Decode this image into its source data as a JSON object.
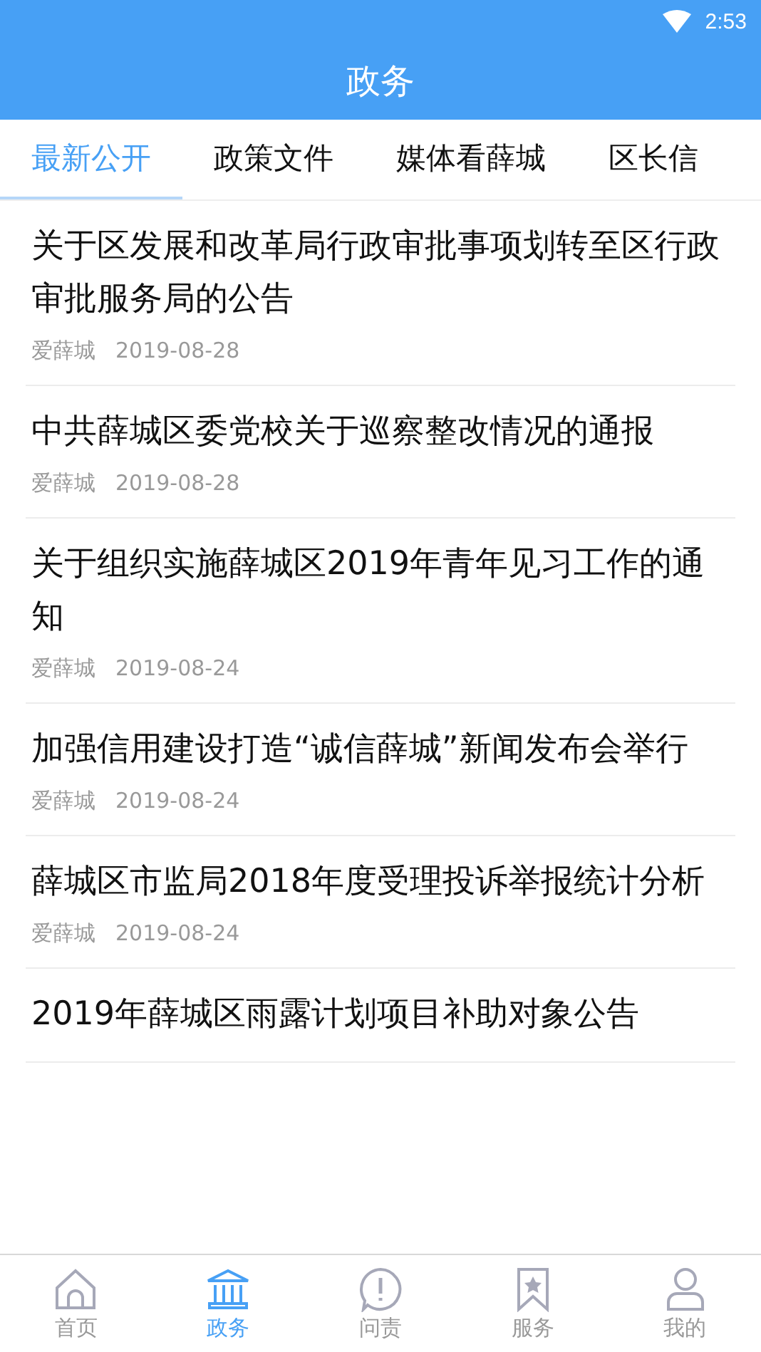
{
  "status_bar": {
    "time": "2:53"
  },
  "header": {
    "title": "政务"
  },
  "tabs": [
    {
      "label": "最新公开",
      "selected": true
    },
    {
      "label": "政策文件",
      "selected": false
    },
    {
      "label": "媒体看薛城",
      "selected": false
    },
    {
      "label": "区长信",
      "selected": false
    }
  ],
  "articles": [
    {
      "title": "关于区发展和改革局行政审批事项划转至区行政审批服务局的公告",
      "source": "爱薛城",
      "date": "2019-08-28"
    },
    {
      "title": "中共薛城区委党校关于巡察整改情况的通报",
      "source": "爱薛城",
      "date": "2019-08-28"
    },
    {
      "title": "关于组织实施薛城区2019年青年见习工作的通知",
      "source": "爱薛城",
      "date": "2019-08-24"
    },
    {
      "title": "加强信用建设打造“诚信薛城”新闻发布会举行",
      "source": "爱薛城",
      "date": "2019-08-24"
    },
    {
      "title": "薛城区市监局2018年度受理投诉举报统计分析",
      "source": "爱薛城",
      "date": "2019-08-24"
    },
    {
      "title": "2019年薛城区雨露计划项目补助对象公告"
    }
  ],
  "bottom_nav": [
    {
      "kind": "home",
      "label": "首页",
      "selected": false
    },
    {
      "kind": "government",
      "label": "政务",
      "selected": true
    },
    {
      "kind": "question",
      "label": "问责",
      "selected": false
    },
    {
      "kind": "service",
      "label": "服务",
      "selected": false
    },
    {
      "kind": "profile",
      "label": "我的",
      "selected": false
    }
  ]
}
